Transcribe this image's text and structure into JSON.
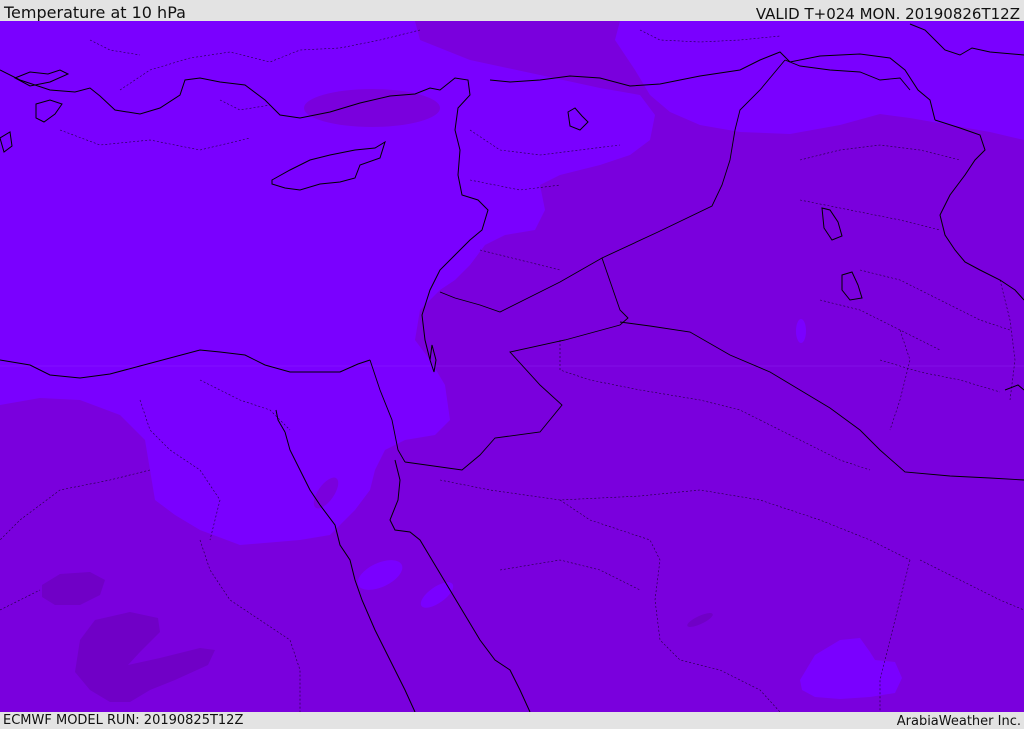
{
  "header": {
    "title": "Temperature at 10 hPa",
    "valid": "VALID T+024 MON. 20190826T12Z"
  },
  "footer": {
    "model_run": "ECMWF MODEL RUN: 20190825T12Z",
    "credit": "ArabiaWeather Inc."
  },
  "colors": {
    "light_violet": "#7a00ff",
    "mid_violet": "#7a00dd",
    "dark_violet": "#7000c6",
    "border_line": "#000000",
    "header_bg": "#e3e3e3"
  }
}
